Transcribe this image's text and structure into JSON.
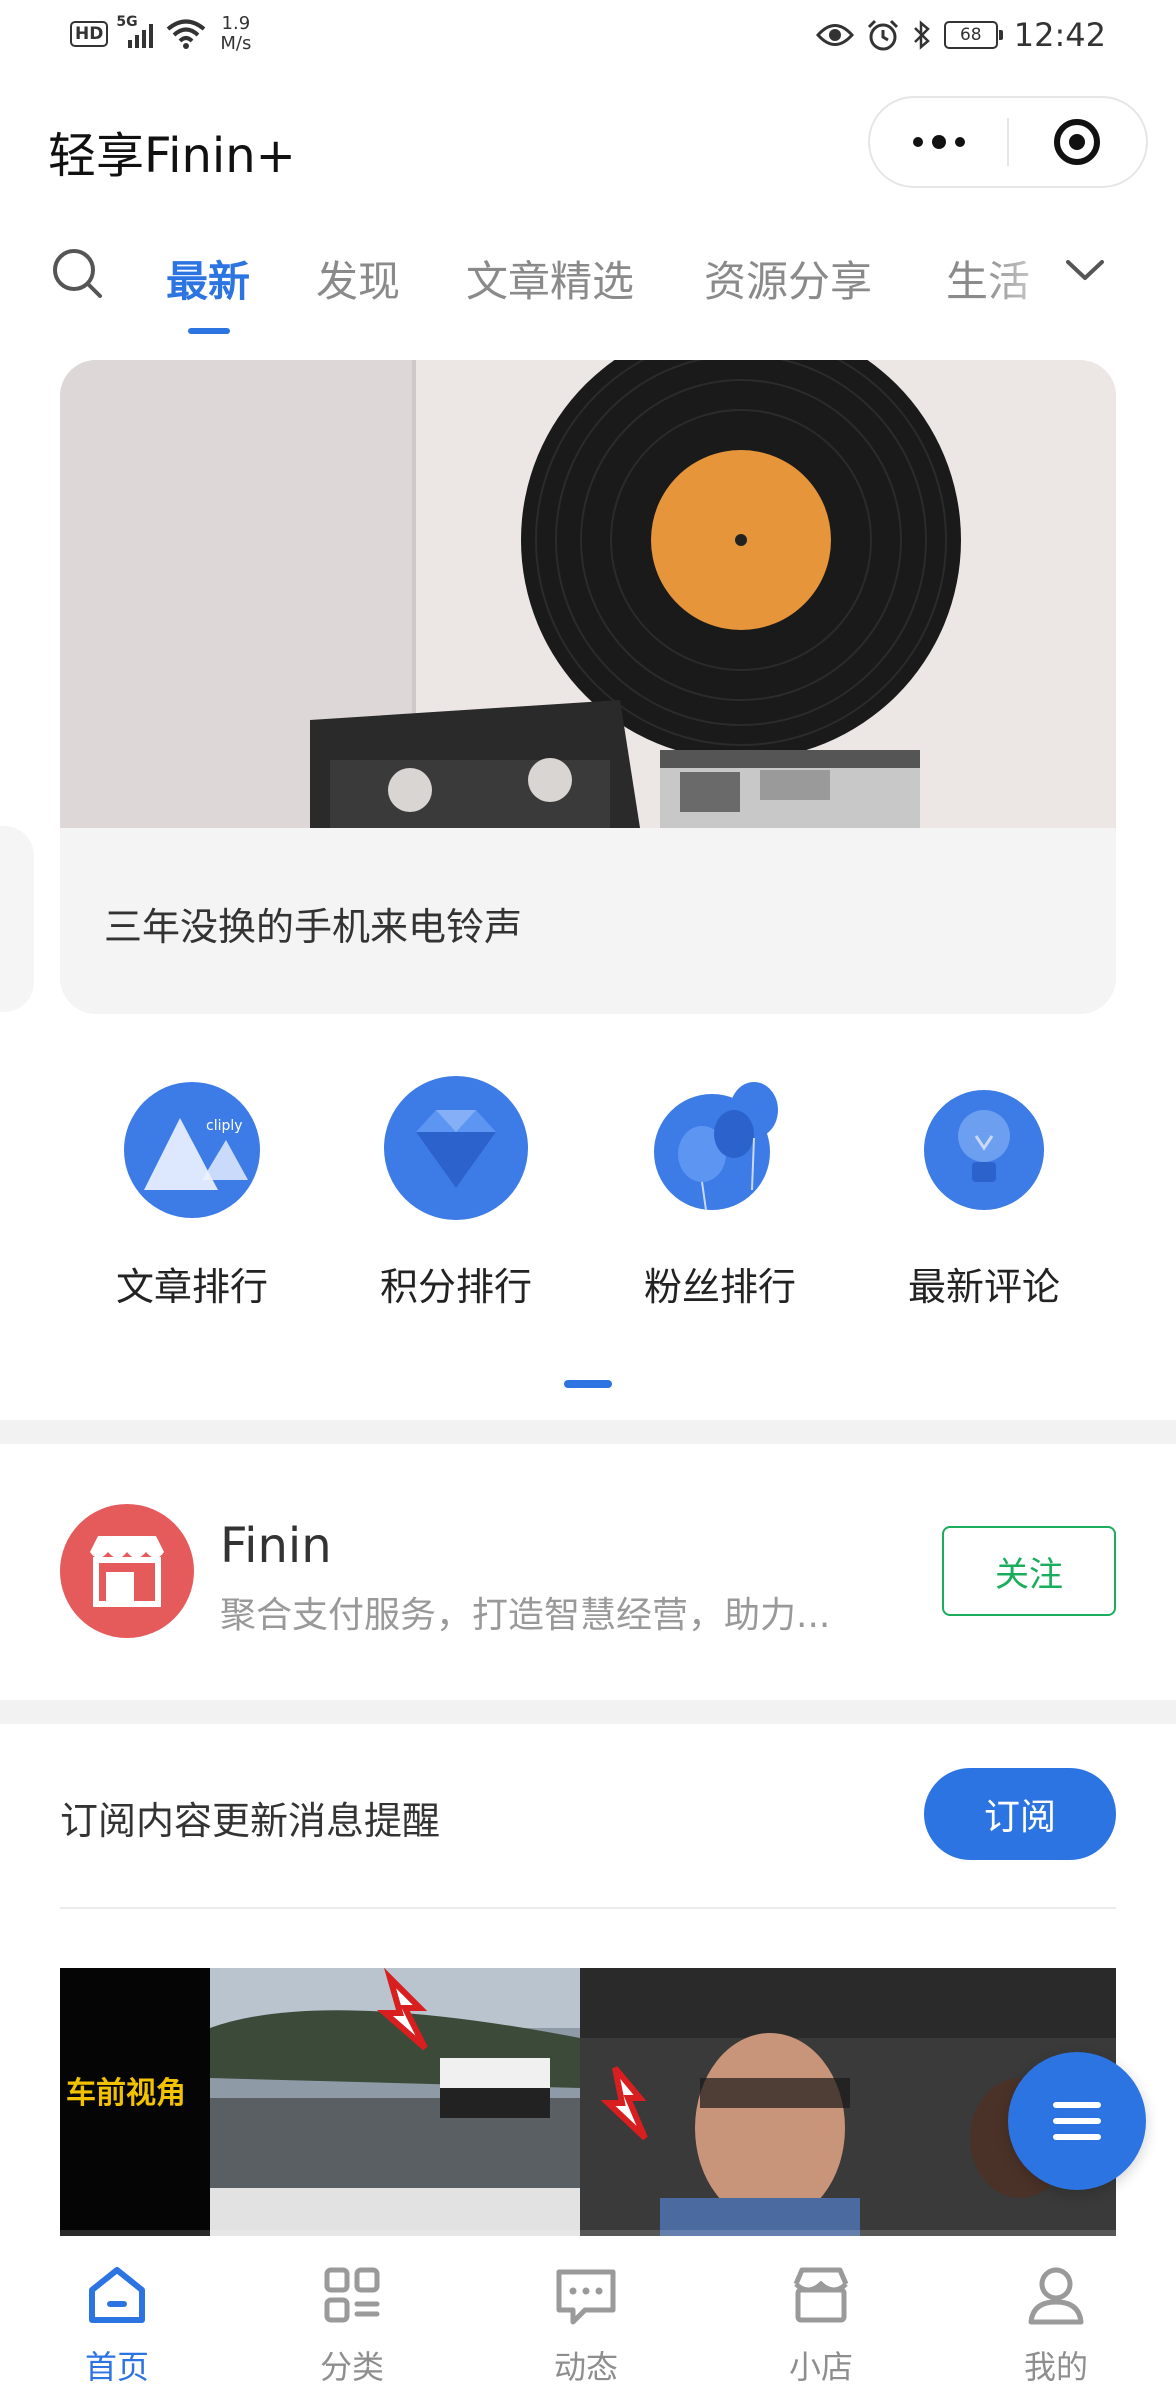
{
  "status_bar": {
    "hd": "HD",
    "network": "5G",
    "speed_value": "1.9",
    "speed_unit": "M/s",
    "battery": "68",
    "time": "12:42"
  },
  "title_bar": {
    "title": "轻享Finin+"
  },
  "tabs": {
    "items": [
      "最新",
      "发现",
      "文章精选",
      "资源分享",
      "生活"
    ],
    "active_index": 0
  },
  "banner": {
    "caption": "三年没换的手机来电铃声"
  },
  "quick_links": [
    {
      "label": "文章排行",
      "icon": "mountain-icon",
      "badge": "cliply"
    },
    {
      "label": "积分排行",
      "icon": "diamond-icon"
    },
    {
      "label": "粉丝排行",
      "icon": "balloons-icon"
    },
    {
      "label": "最新评论",
      "icon": "lightbulb-icon"
    }
  ],
  "shop": {
    "name": "Finin",
    "description": "聚合支付服务，打造智慧经营，助力...",
    "follow_label": "关注"
  },
  "subscribe": {
    "text": "订阅内容更新消息提醒",
    "button_label": "订阅"
  },
  "video": {
    "overlay_text": "车前视角"
  },
  "bottom_nav": {
    "items": [
      {
        "label": "首页",
        "icon": "home-icon"
      },
      {
        "label": "分类",
        "icon": "category-icon"
      },
      {
        "label": "动态",
        "icon": "message-icon"
      },
      {
        "label": "小店",
        "icon": "store-icon"
      },
      {
        "label": "我的",
        "icon": "user-icon"
      }
    ],
    "active_index": 0
  },
  "colors": {
    "accent": "#2d74e3",
    "follow_green": "#1aad5c",
    "shop_avatar_red": "#e55a5a"
  }
}
